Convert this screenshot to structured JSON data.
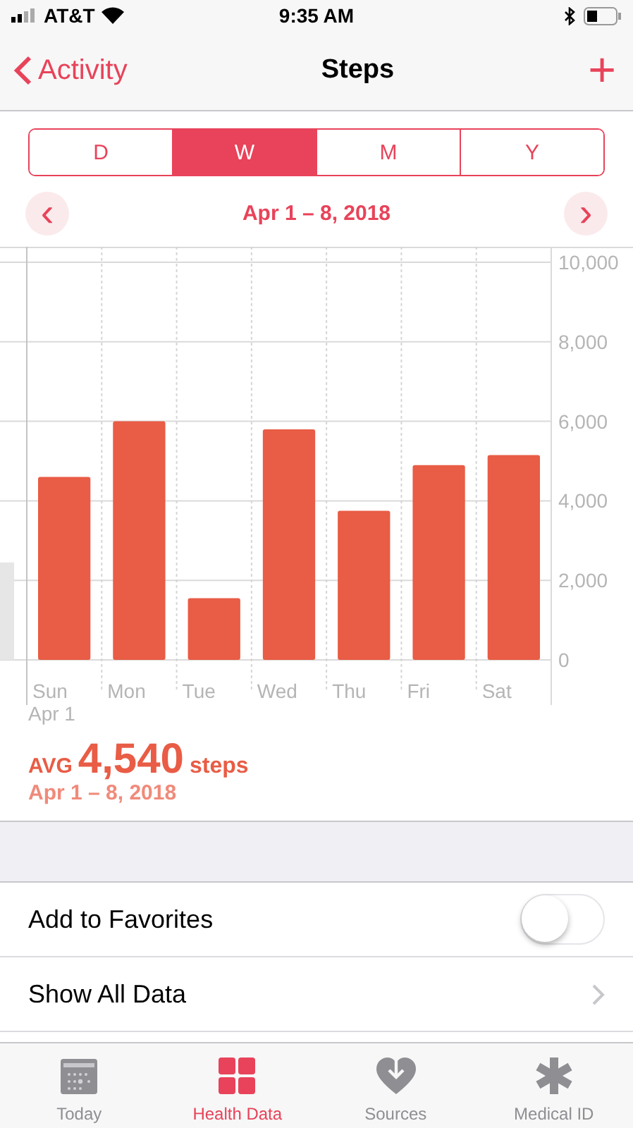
{
  "status_bar": {
    "carrier": "AT&T",
    "time": "9:35 AM"
  },
  "nav": {
    "back": "Activity",
    "title": "Steps",
    "add": "+"
  },
  "segments": [
    {
      "label": "D",
      "selected": false
    },
    {
      "label": "W",
      "selected": true
    },
    {
      "label": "M",
      "selected": false
    },
    {
      "label": "Y",
      "selected": false
    }
  ],
  "range": {
    "prev": "‹",
    "label": "Apr 1 – 8, 2018",
    "next": "›"
  },
  "chart": {
    "start_label": "Apr 1",
    "chart_data": {
      "type": "bar",
      "categories": [
        "Sun",
        "Mon",
        "Tue",
        "Wed",
        "Thu",
        "Fri",
        "Sat"
      ],
      "grid": true,
      "series": [
        {
          "color": "#e95c45",
          "values": [
            4600,
            6000,
            1550,
            5800,
            3750,
            4900,
            5150
          ]
        }
      ],
      "ylim": [
        0,
        10000
      ],
      "yticks": [
        {
          "value": 0,
          "label": "0"
        },
        {
          "value": 2000,
          "label": "2,000"
        },
        {
          "value": 4000,
          "label": "4,000"
        },
        {
          "value": 6000,
          "label": "6,000"
        },
        {
          "value": 8000,
          "label": "8,000"
        },
        {
          "value": 10000,
          "label": "10,000"
        }
      ]
    }
  },
  "summary": {
    "prefix": "AVG",
    "value": "4,540",
    "unit": "steps",
    "range": "Apr 1 – 8, 2018"
  },
  "rows": [
    {
      "kind": "toggle",
      "label": "Add to Favorites",
      "on": false
    },
    {
      "kind": "link",
      "label": "Show All Data"
    }
  ],
  "tabs": [
    {
      "label": "Today",
      "selected": false
    },
    {
      "label": "Health Data",
      "selected": true
    },
    {
      "label": "Sources",
      "selected": false
    },
    {
      "label": "Medical ID",
      "selected": false
    }
  ]
}
